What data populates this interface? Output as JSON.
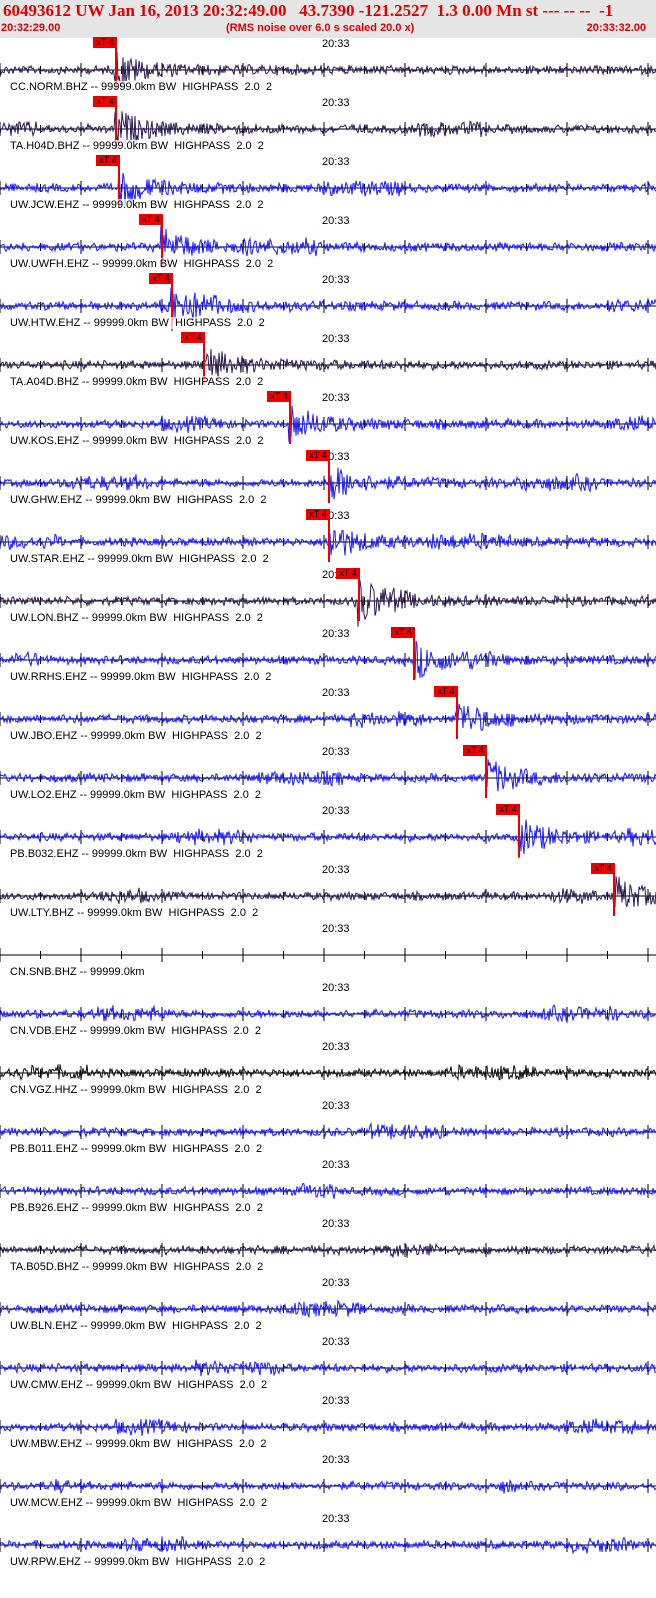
{
  "header": {
    "title": "60493612 UW Jan 16, 2013 20:32:49.00   43.7390 -121.2527  1.3 0.00 Mn st --- -- --  -1",
    "start_time": "20:32:29.00",
    "note": "(RMS noise over 6.0 s scaled 20.0 x)",
    "end_time": "20:33:32.00",
    "color": "#e00000",
    "background": "#e6e6e6"
  },
  "colors": {
    "blue": "#1a1aff",
    "dark": "#2b1a55",
    "black": "#111111",
    "pick": "#ee0000"
  },
  "traces": [
    {
      "label": "CC.NORM.BHZ -- 99999.0km BW  HIGHPASS  2.0  2",
      "time": "20:33",
      "color": "dark",
      "pick_label": "xT 4",
      "pick_fraction": 0.175
    },
    {
      "label": "TA.H04D.BHZ -- 99999.0km BW  HIGHPASS  2.0  2",
      "time": "20:33",
      "color": "dark",
      "pick_label": "xT 4",
      "pick_fraction": 0.175
    },
    {
      "label": "UW.JCW.EHZ -- 99999.0km BW  HIGHPASS  2.0  2",
      "time": "20:33",
      "color": "blue",
      "pick_label": "xT 4",
      "pick_fraction": 0.18
    },
    {
      "label": "UW.UWFH.EHZ -- 99999.0km BW  HIGHPASS  2.0  2",
      "time": "20:33",
      "color": "blue",
      "pick_label": "xT 4",
      "pick_fraction": 0.245
    },
    {
      "label": "UW.HTW.EHZ -- 99999.0km BW  HIGHPASS  2.0  2",
      "time": "20:33",
      "color": "blue",
      "pick_label": "xT 4",
      "pick_fraction": 0.26
    },
    {
      "label": "TA.A04D.BHZ -- 99999.0km BW  HIGHPASS  2.0  2",
      "time": "20:33",
      "color": "dark",
      "pick_label": "xT 4",
      "pick_fraction": 0.31
    },
    {
      "label": "UW.KOS.EHZ -- 99999.0km BW  HIGHPASS  2.0  2",
      "time": "20:33",
      "color": "blue",
      "pick_label": "xT 4",
      "pick_fraction": 0.44
    },
    {
      "label": "UW.GHW.EHZ -- 99999.0km BW  HIGHPASS  2.0  2",
      "time": "20:33",
      "color": "blue",
      "pick_label": "xT 4",
      "pick_fraction": 0.5
    },
    {
      "label": "UW.STAR.EHZ -- 99999.0km BW  HIGHPASS  2.0  2",
      "time": "20:33",
      "color": "blue",
      "pick_label": "xT 4",
      "pick_fraction": 0.5
    },
    {
      "label": "UW.LON.BHZ -- 99999.0km BW  HIGHPASS  2.0  2",
      "time": "20:33",
      "color": "dark",
      "pick_label": "xT 4",
      "pick_fraction": 0.545
    },
    {
      "label": "UW.RRHS.EHZ -- 99999.0km BW  HIGHPASS  2.0  2",
      "time": "20:33",
      "color": "blue",
      "pick_label": "xT 4",
      "pick_fraction": 0.63
    },
    {
      "label": "UW.JBO.EHZ -- 99999.0km BW  HIGHPASS  2.0  2",
      "time": "20:33",
      "color": "blue",
      "pick_label": "xT 4",
      "pick_fraction": 0.695
    },
    {
      "label": "UW.LO2.EHZ -- 99999.0km BW  HIGHPASS  2.0  2",
      "time": "20:33",
      "color": "blue",
      "pick_label": "xT 4",
      "pick_fraction": 0.74
    },
    {
      "label": "PB.B032.EHZ -- 99999.0km BW  HIGHPASS  2.0  2",
      "time": "20:33",
      "color": "blue",
      "pick_label": "xT 4",
      "pick_fraction": 0.79
    },
    {
      "label": "UW.LTY.BHZ -- 99999.0km BW  HIGHPASS  2.0  2",
      "time": "20:33",
      "color": "dark",
      "pick_label": "xT 4",
      "pick_fraction": 0.935
    },
    {
      "label": "CN.SNB.BHZ -- 99999.0km",
      "time": "20:33",
      "color": "none"
    },
    {
      "label": "CN.VDB.EHZ -- 99999.0km BW  HIGHPASS  2.0  2",
      "time": "20:33",
      "color": "blue"
    },
    {
      "label": "CN.VGZ.HHZ -- 99999.0km BW  HIGHPASS  2.0  2",
      "time": "20:33",
      "color": "black"
    },
    {
      "label": "PB.B011.EHZ -- 99999.0km BW  HIGHPASS  2.0  2",
      "time": "20:33",
      "color": "blue"
    },
    {
      "label": "PB.B926.EHZ -- 99999.0km BW  HIGHPASS  2.0  2",
      "time": "20:33",
      "color": "blue"
    },
    {
      "label": "TA.B05D.BHZ -- 99999.0km BW  HIGHPASS  2.0  2",
      "time": "20:33",
      "color": "dark"
    },
    {
      "label": "UW.BLN.EHZ -- 99999.0km BW  HIGHPASS  2.0  2",
      "time": "20:33",
      "color": "blue"
    },
    {
      "label": "UW.CMW.EHZ -- 99999.0km BW  HIGHPASS  2.0  2",
      "time": "20:33",
      "color": "blue"
    },
    {
      "label": "UW.MBW.EHZ -- 99999.0km BW  HIGHPASS  2.0  2",
      "time": "20:33",
      "color": "blue"
    },
    {
      "label": "UW.MCW.EHZ -- 99999.0km BW  HIGHPASS  2.0  2",
      "time": "20:33",
      "color": "blue"
    },
    {
      "label": "UW.RPW.EHZ -- 99999.0km BW  HIGHPASS  2.0  2",
      "time": "20:33",
      "color": "blue"
    }
  ]
}
